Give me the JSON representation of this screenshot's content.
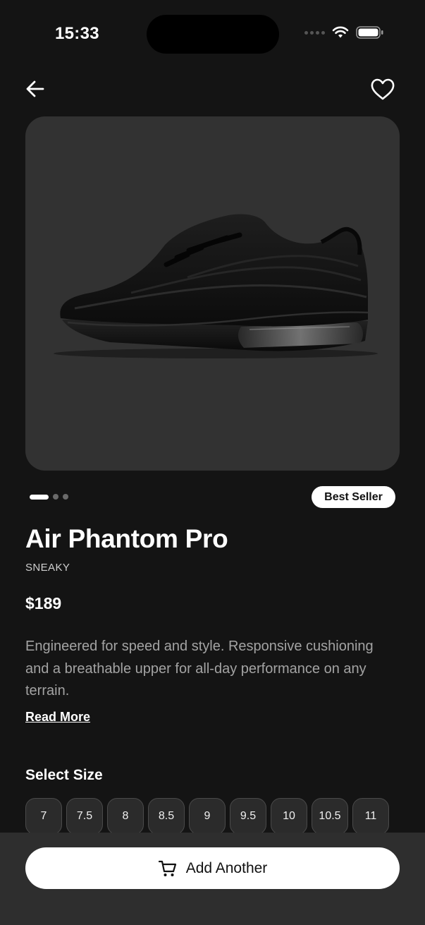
{
  "status": {
    "time": "15:33"
  },
  "product": {
    "name": "Air Phantom Pro",
    "brand": "SNEAKY",
    "price": "$189",
    "badge": "Best Seller",
    "description": "Engineered for speed and style. Responsive cushioning and a breathable upper for all-day performance on any terrain.",
    "read_more": "Read More",
    "image_count": 3,
    "image_index": 1
  },
  "sizes": {
    "label": "Select Size",
    "options": [
      "7",
      "7.5",
      "8",
      "8.5",
      "9",
      "9.5",
      "10",
      "10.5",
      "11"
    ]
  },
  "cta": {
    "label": "Add Another",
    "icon": "cart-icon"
  },
  "icons": [
    "back-arrow-icon",
    "heart-icon",
    "wifi-icon",
    "battery-icon",
    "cart-icon"
  ],
  "colors": {
    "background": "#141414",
    "card": "#323232",
    "accent": "#ffffff",
    "chip": "#2b2b2b"
  }
}
